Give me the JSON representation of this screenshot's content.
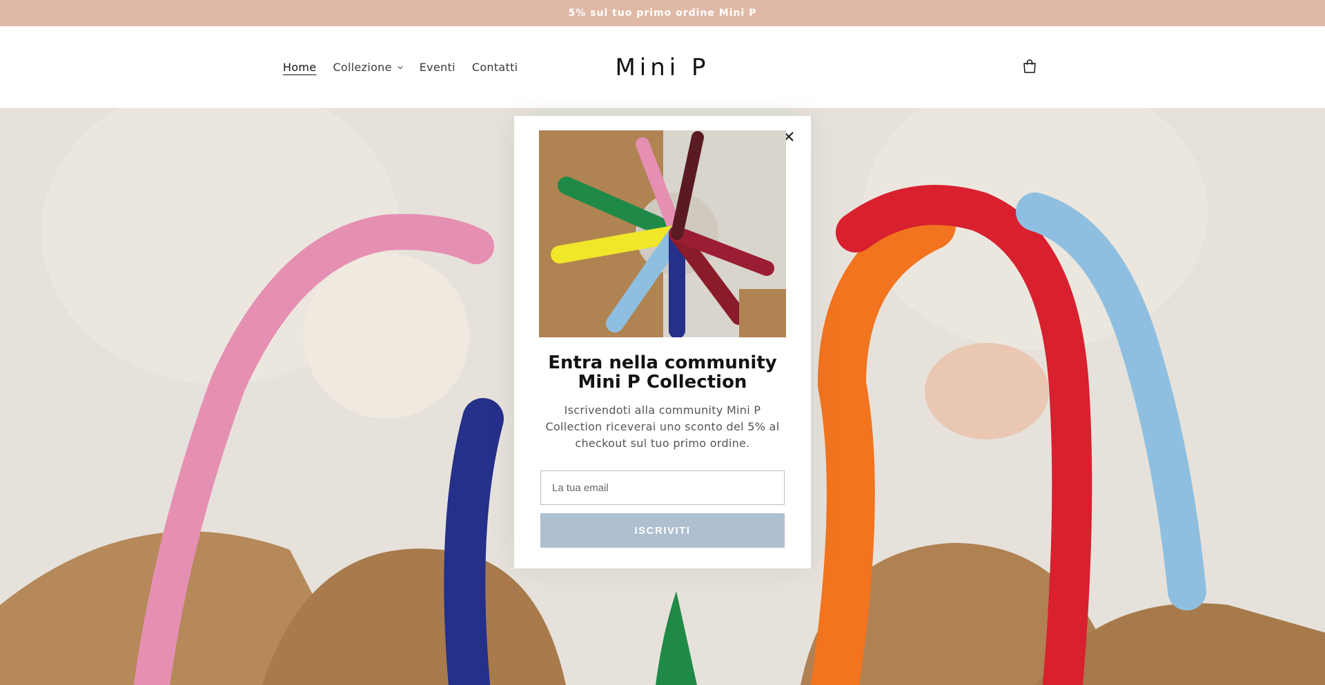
{
  "announcement": {
    "text": "5% sul tuo primo ordine Mini P"
  },
  "header": {
    "nav": [
      {
        "label": "Home",
        "active": true
      },
      {
        "label": "Collezione",
        "has_dropdown": true
      },
      {
        "label": "Eventi"
      },
      {
        "label": "Contatti"
      }
    ],
    "logo": "Mini P",
    "cart_icon": "cart-icon"
  },
  "popup": {
    "close_icon": "close-icon",
    "title": "Entra nella community Mini P Collection",
    "description": "Iscrivendoti alla community Mini P Collection riceverai uno sconto del 5% al checkout sul tuo primo ordine.",
    "email_placeholder": "La tua email",
    "button_label": "ISCRIVITI"
  },
  "colors": {
    "announcement_bg": "#dfb8a6",
    "button_bg": "#aebfcf",
    "text": "#121212"
  }
}
